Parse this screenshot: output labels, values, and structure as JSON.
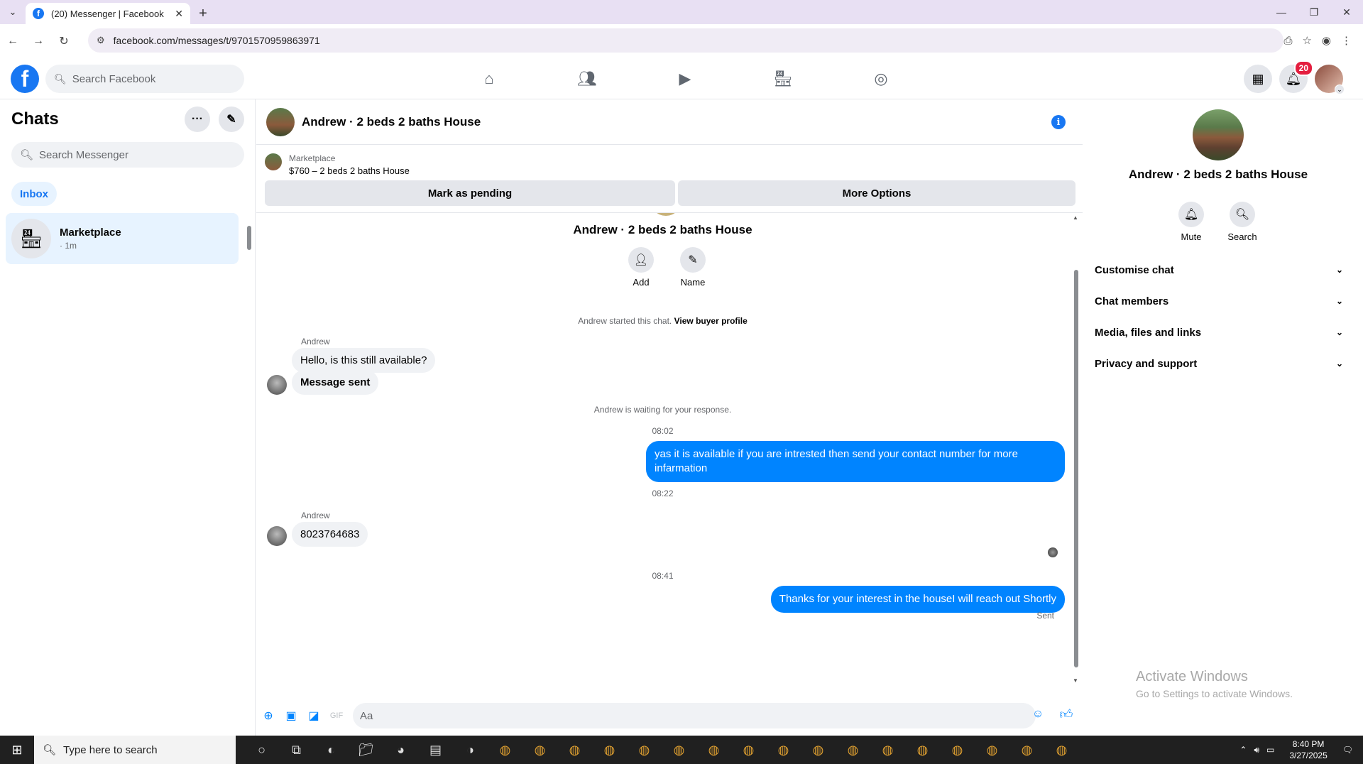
{
  "browser": {
    "tab_title": "(20) Messenger | Facebook",
    "url": "facebook.com/messages/t/9701570959863971",
    "new_tab_symbol": "+"
  },
  "fb": {
    "search_placeholder": "Search Facebook",
    "notification_count": "20",
    "brand_color": "#1877f2"
  },
  "left": {
    "title": "Chats",
    "search_placeholder": "Search Messenger",
    "filter_label": "Inbox",
    "chat_items": [
      {
        "name": "Marketplace",
        "time": "· 1m"
      }
    ]
  },
  "conversation": {
    "title": "Andrew · 2 beds 2 baths House",
    "marketplace_label": "Marketplace",
    "listing": "$760 – 2 beds 2 baths House",
    "pending_button": "Mark as pending",
    "more_button": "More Options",
    "thread_title": "Andrew · 2 beds 2 baths House",
    "add_label": "Add",
    "name_label": "Name",
    "started_text": "Andrew started this chat.",
    "buyer_profile_link": "View buyer profile",
    "messages": {
      "sender1": "Andrew",
      "msg1": "Hello, is this still available?",
      "msg2": "Message sent",
      "waiting": "Andrew is waiting for your response.",
      "time1": "08:02",
      "out1": "yas it is available if you are intrested then send your contact number for more infarmation",
      "time2": "08:22",
      "sender2": "Andrew",
      "msg3": "8023764683",
      "time3": "08:41",
      "out2": "Thanks for your interest in the houseI will reach out Shortly",
      "sent_status": "Sent"
    },
    "composer_placeholder": "Aa",
    "out_bubble_color": "#0084ff"
  },
  "right": {
    "title": "Andrew · 2 beds 2 baths House",
    "mute_label": "Mute",
    "search_label": "Search",
    "sections": [
      "Customise chat",
      "Chat members",
      "Media, files and links",
      "Privacy and support"
    ]
  },
  "watermark": {
    "line1": "Activate Windows",
    "line2": "Go to Settings to activate Windows."
  },
  "taskbar": {
    "search_placeholder": "Type here to search",
    "time": "8:40 PM",
    "date": "3/27/2025"
  }
}
